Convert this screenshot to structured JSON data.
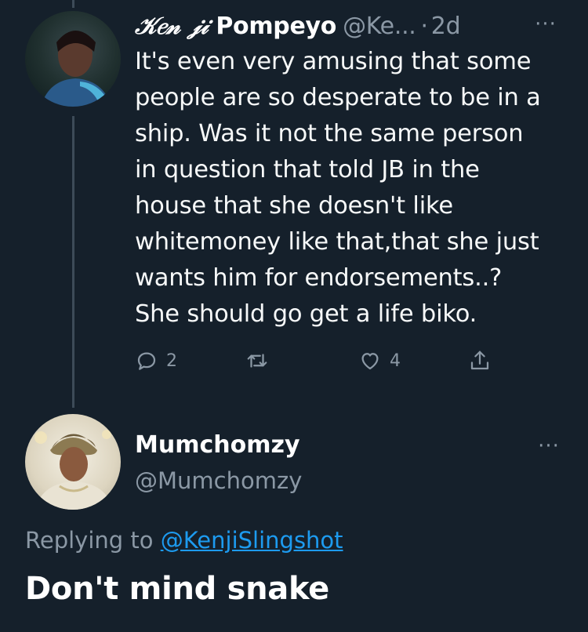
{
  "tweet1": {
    "display_name_styled": "𝒦𝑒𝓃 𝒿𝒾",
    "display_name_plain": "Pompeyo",
    "handle": "@Ke...",
    "separator": "·",
    "time": "2d",
    "more_label": "···",
    "body_lines": [
      "It's even very amusing that some",
      "people are so desperate to be in a",
      "ship. Was it not the same person",
      "in question that told JB in the",
      "house that she doesn't like",
      "whitemoney like that,that she just",
      "wants him for endorsements..?",
      "She should go get a life biko."
    ],
    "actions": {
      "reply_count": "2",
      "retweet_count": "",
      "like_count": "4"
    }
  },
  "tweet2": {
    "display_name": "Mumchomzy",
    "handle": "@Mumchomzy",
    "more_label": "···",
    "replying_prefix": "Replying to ",
    "replying_to": "@KenjiSlingshot",
    "body": "Don't mind snake"
  },
  "icons": {
    "reply": "reply-icon",
    "retweet": "retweet-icon",
    "like": "heart-icon",
    "share": "share-icon",
    "more": "more-icon"
  },
  "colors": {
    "background": "#15202b",
    "muted": "#8b98a5",
    "link": "#1d9bf0",
    "thread_line": "#3d4b58"
  }
}
